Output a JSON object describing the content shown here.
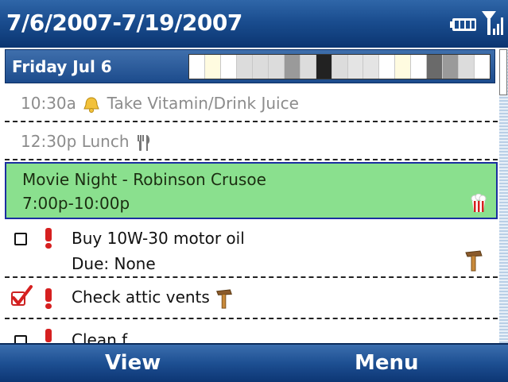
{
  "title_bar": {
    "date_range": "7/6/2007-7/19/2007",
    "icons": [
      "battery-icon",
      "signal-icon"
    ]
  },
  "day_header": {
    "label": "Friday Jul 6",
    "timebar_colors": [
      "#ffffff",
      "#fffbe0",
      "#ffffff",
      "#dcdcdc",
      "#dcdcdc",
      "#dcdcdc",
      "#9a9a9a",
      "#dcdcdc",
      "#222222",
      "#dcdcdc",
      "#e4e4e4",
      "#e4e4e4",
      "#ffffff",
      "#fffbe0",
      "#ffffff",
      "#6a6a6a",
      "#9a9a9a",
      "#dcdcdc",
      "#ffffff"
    ]
  },
  "items": [
    {
      "type": "appointment",
      "time": "10:30a",
      "icon": "bell-icon",
      "text": "Take Vitamin/Drink Juice"
    },
    {
      "type": "appointment",
      "time": "12:30p",
      "icon": "fork-knife-icon",
      "text": "Lunch"
    },
    {
      "type": "event",
      "title": "Movie Night - Robinson Crusoe",
      "time": "7:00p-10:00p",
      "icon": "popcorn-icon",
      "selected": true
    },
    {
      "type": "task",
      "checked": false,
      "priority": "high",
      "title": "Buy 10W-30 motor oil",
      "due": "Due: None",
      "icon": "hammer-icon"
    },
    {
      "type": "task",
      "checked": true,
      "priority": "high",
      "title": "Check attic vents",
      "icon": "hammer-icon"
    },
    {
      "type": "task",
      "checked": false,
      "priority": "high",
      "title": "Clean f"
    }
  ],
  "softkeys": {
    "left": "View",
    "right": "Menu"
  },
  "colors": {
    "header_blue": "#1a4d8f",
    "selected_event_bg": "#8ae08e",
    "selection_border": "#1b2fa0",
    "priority_red": "#d62020"
  }
}
